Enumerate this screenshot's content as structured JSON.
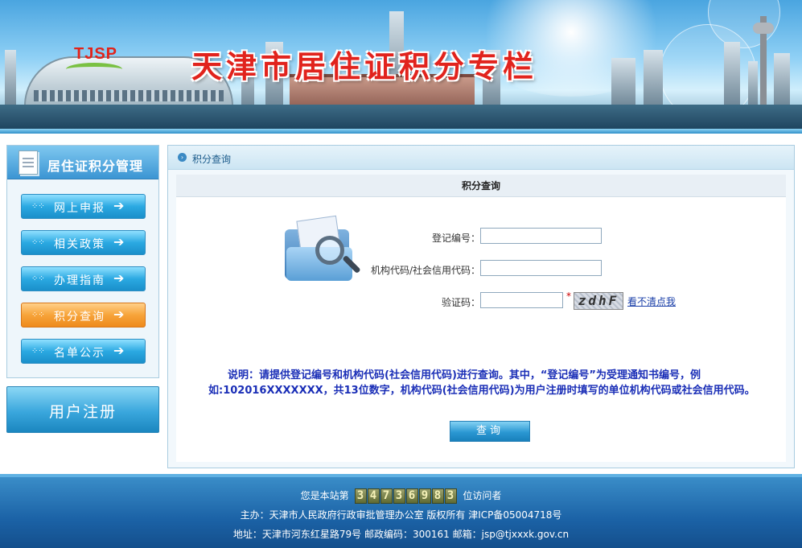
{
  "banner": {
    "logo_text": "TJSP",
    "title": "天津市居住证积分专栏"
  },
  "sidebar": {
    "heading": "居住证积分管理",
    "items": [
      {
        "label": "网上申报",
        "active": false
      },
      {
        "label": "相关政策",
        "active": false
      },
      {
        "label": "办理指南",
        "active": false
      },
      {
        "label": "积分查询",
        "active": true
      },
      {
        "label": "名单公示",
        "active": false
      }
    ],
    "register_label": "用户注册"
  },
  "main": {
    "breadcrumb": "积分查询",
    "panel_title": "积分查询",
    "form": {
      "reg_no_label": "登记编号：",
      "reg_no_value": "",
      "org_code_label": "机构代码/社会信用代码：",
      "org_code_value": "",
      "captcha_label": "验证码：",
      "captcha_value": "",
      "captcha_required_mark": "*",
      "captcha_image_text": "zdhF",
      "refresh_link": "看不清点我"
    },
    "note": "说明：请提供登记编号和机构代码(社会信用代码)进行查询。其中，“登记编号”为受理通知书编号，例如:102016XXXXXXX，共13位数字，机构代码(社会信用代码)为用户注册时填写的单位机构代码或社会信用代码。",
    "query_button": "查询"
  },
  "footer": {
    "visitor_prefix": "您是本站第",
    "visitor_count": "34736983",
    "visitor_suffix": "位访问者",
    "sponsor": "主办：天津市人民政府行政审批管理办公室 版权所有 津ICP备05004718号",
    "address": "地址：天津市河东红星路79号 邮政编码：300161 邮箱：jsp@tjxxxk.gov.cn"
  },
  "colors": {
    "title_red": "#e1231d",
    "menu_blue": "#2ba9e2",
    "menu_active_orange": "#f7a43a",
    "note_blue": "#1b2fb7",
    "footer_blue": "#1b62a6"
  },
  "icons": {
    "menu_dots": "grid-dots-icon",
    "menu_arrow": "arrow-right-icon",
    "section_bullet": "circle-chevron-icon",
    "header_doc": "document-icon",
    "search_illustration": "folder-magnifier-icon"
  }
}
